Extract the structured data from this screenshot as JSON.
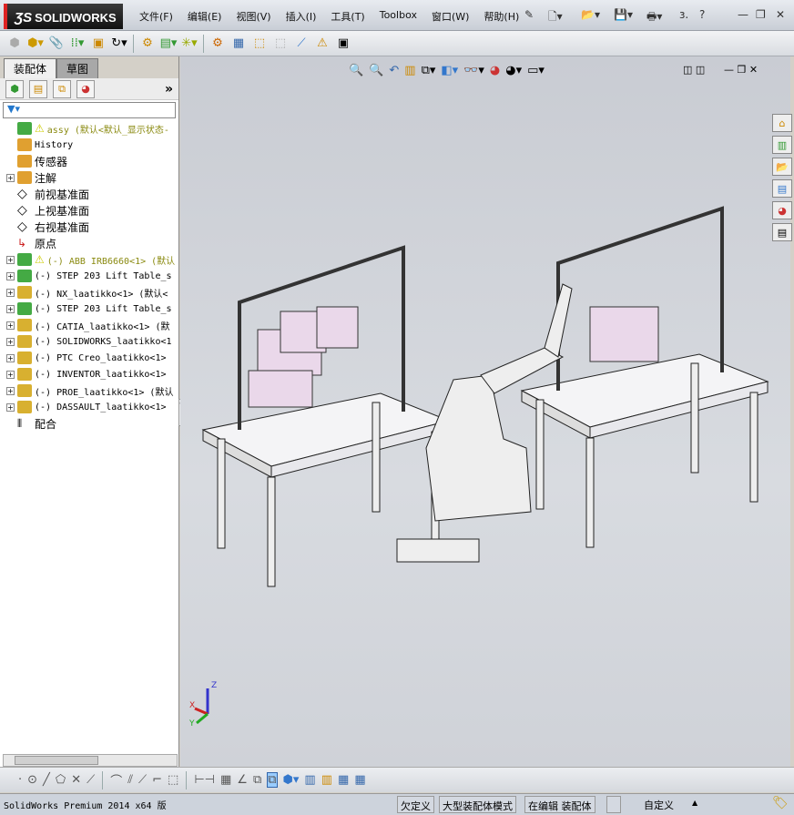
{
  "app": {
    "logo": "SOLIDWORKS",
    "logo_mark": "DS"
  },
  "menu": [
    "文件(F)",
    "编辑(E)",
    "视图(V)",
    "插入(I)",
    "工具(T)",
    "Toolbox",
    "窗口(W)",
    "帮助(H)"
  ],
  "window_buttons": {
    "help": "?",
    "minimize": "—",
    "restore": "❐",
    "close": "✕"
  },
  "left_panel": {
    "tabs": [
      "装配体",
      "草图"
    ],
    "expand": "»",
    "tree": [
      {
        "label": "assy  (默认<默认_显示状态-",
        "type": "assembly",
        "warn": true,
        "expandable": false,
        "style": "olive",
        "mono": true
      },
      {
        "label": "History",
        "type": "history",
        "expandable": false,
        "mono": true
      },
      {
        "label": "传感器",
        "type": "sensor",
        "expandable": false
      },
      {
        "label": "注解",
        "type": "annotation",
        "expandable": true
      },
      {
        "label": "前视基准面",
        "type": "plane",
        "expandable": false
      },
      {
        "label": "上视基准面",
        "type": "plane",
        "expandable": false
      },
      {
        "label": "右视基准面",
        "type": "plane",
        "expandable": false
      },
      {
        "label": "原点",
        "type": "origin",
        "expandable": false
      },
      {
        "label": "(-) ABB IRB6660<1> (默认",
        "type": "assembly",
        "warn": true,
        "expandable": true,
        "style": "olive",
        "mono": true
      },
      {
        "label": "(-) STEP 203 Lift Table_s",
        "type": "assembly",
        "expandable": true,
        "mono": true
      },
      {
        "label": "(-) NX_laatikko<1> (默认<",
        "type": "part",
        "expandable": true,
        "mono": true
      },
      {
        "label": "(-) STEP 203 Lift Table_s",
        "type": "assembly",
        "expandable": true,
        "mono": true
      },
      {
        "label": "(-) CATIA_laatikko<1> (默",
        "type": "part",
        "expandable": true,
        "mono": true
      },
      {
        "label": "(-) SOLIDWORKS_laatikko<1",
        "type": "part",
        "expandable": true,
        "mono": true
      },
      {
        "label": "(-) PTC Creo_laatikko<1>",
        "type": "part",
        "expandable": true,
        "mono": true
      },
      {
        "label": "(-) INVENTOR_laatikko<1>",
        "type": "part",
        "expandable": true,
        "mono": true
      },
      {
        "label": "(-) PROE_laatikko<1> (默认",
        "type": "part",
        "expandable": true,
        "mono": true
      },
      {
        "label": "(-) DASSAULT_laatikko<1>",
        "type": "part",
        "expandable": true,
        "mono": true
      },
      {
        "label": "配合",
        "type": "mates",
        "expandable": false
      }
    ]
  },
  "triad": {
    "x": "X",
    "y": "Y",
    "z": "Z"
  },
  "status": {
    "product": "SolidWorks Premium 2014 x64 版",
    "cells": [
      "欠定义",
      "大型装配体模式",
      "在编辑 装配体"
    ],
    "units": "自定义",
    "arrow": "▲"
  },
  "colors": {
    "viewport_top": "#c9ccd3",
    "tree_olive": "#8a8a10",
    "box_pink": "#e6d8e6"
  }
}
